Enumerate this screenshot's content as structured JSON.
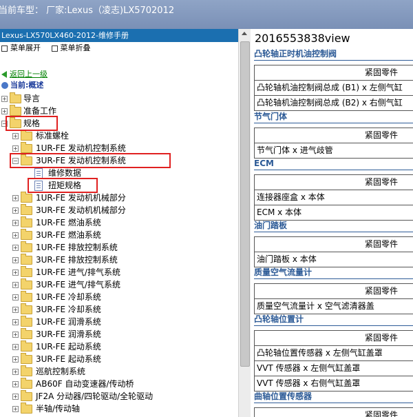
{
  "window": {
    "title": "当前车型：  厂家:Lexus（凌志)LX5702012"
  },
  "left_panel": {
    "header": "Lexus-LX570LX460-2012-维修手册",
    "menu": {
      "expand": "菜单展开",
      "collapse": "菜单折叠"
    },
    "back_link": "返回上一级",
    "current_label": "当前:",
    "current_value": "概述",
    "tree": [
      {
        "label": "导言"
      },
      {
        "label": "准备工作"
      },
      {
        "label": "规格"
      },
      {
        "label": "标准螺栓"
      },
      {
        "label": "1UR-FE 发动机控制系统"
      },
      {
        "label": "3UR-FE 发动机控制系统"
      },
      {
        "label": "维修数据"
      },
      {
        "label": "扭矩规格"
      },
      {
        "label": "1UR-FE 发动机机械部分"
      },
      {
        "label": "3UR-FE 发动机机械部分"
      },
      {
        "label": "1UR-FE 燃油系统"
      },
      {
        "label": "3UR-FE 燃油系统"
      },
      {
        "label": "1UR-FE 排放控制系统"
      },
      {
        "label": "3UR-FE 排放控制系统"
      },
      {
        "label": "1UR-FE 进气/排气系统"
      },
      {
        "label": "3UR-FE 进气/排气系统"
      },
      {
        "label": "1UR-FE 冷却系统"
      },
      {
        "label": "3UR-FE 冷却系统"
      },
      {
        "label": "1UR-FE 润滑系统"
      },
      {
        "label": "3UR-FE 润滑系统"
      },
      {
        "label": "1UR-FE 起动系统"
      },
      {
        "label": "3UR-FE 起动系统"
      },
      {
        "label": "巡航控制系统"
      },
      {
        "label": "AB60F 自动变速器/传动桥"
      },
      {
        "label": "JF2A 分动器/四轮驱动/全轮驱动"
      },
      {
        "label": "半轴/传动轴"
      }
    ]
  },
  "right_panel": {
    "title": "2016553838view",
    "column_header": "紧固零件",
    "sections": [
      {
        "heading": "凸轮轴正时机油控制阀",
        "rows": [
          "凸轮轴机油控制阀总成 (B1) x 左侧气缸",
          "凸轮轴机油控制阀总成 (B2) x 右侧气缸"
        ]
      },
      {
        "heading": "节气门体",
        "rows": [
          "节气门体 x 进气歧管"
        ]
      },
      {
        "heading": "ECM",
        "rows": [
          "连接器座盒 x 本体",
          "ECM x 本体"
        ]
      },
      {
        "heading": "油门踏板",
        "rows": [
          "油门踏板 x 本体"
        ]
      },
      {
        "heading": "质量空气流量计",
        "rows": [
          "质量空气流量计 x 空气滤清器盖"
        ]
      },
      {
        "heading": "凸轮轴位置计",
        "rows": [
          "凸轮轴位置传感器 x 左侧气缸盖罩",
          "VVT 传感器 x 左侧气缸盖罩",
          "VVT 传感器 x 右侧气缸盖罩"
        ]
      },
      {
        "heading": "曲轴位置传感器",
        "rows": []
      }
    ]
  }
}
